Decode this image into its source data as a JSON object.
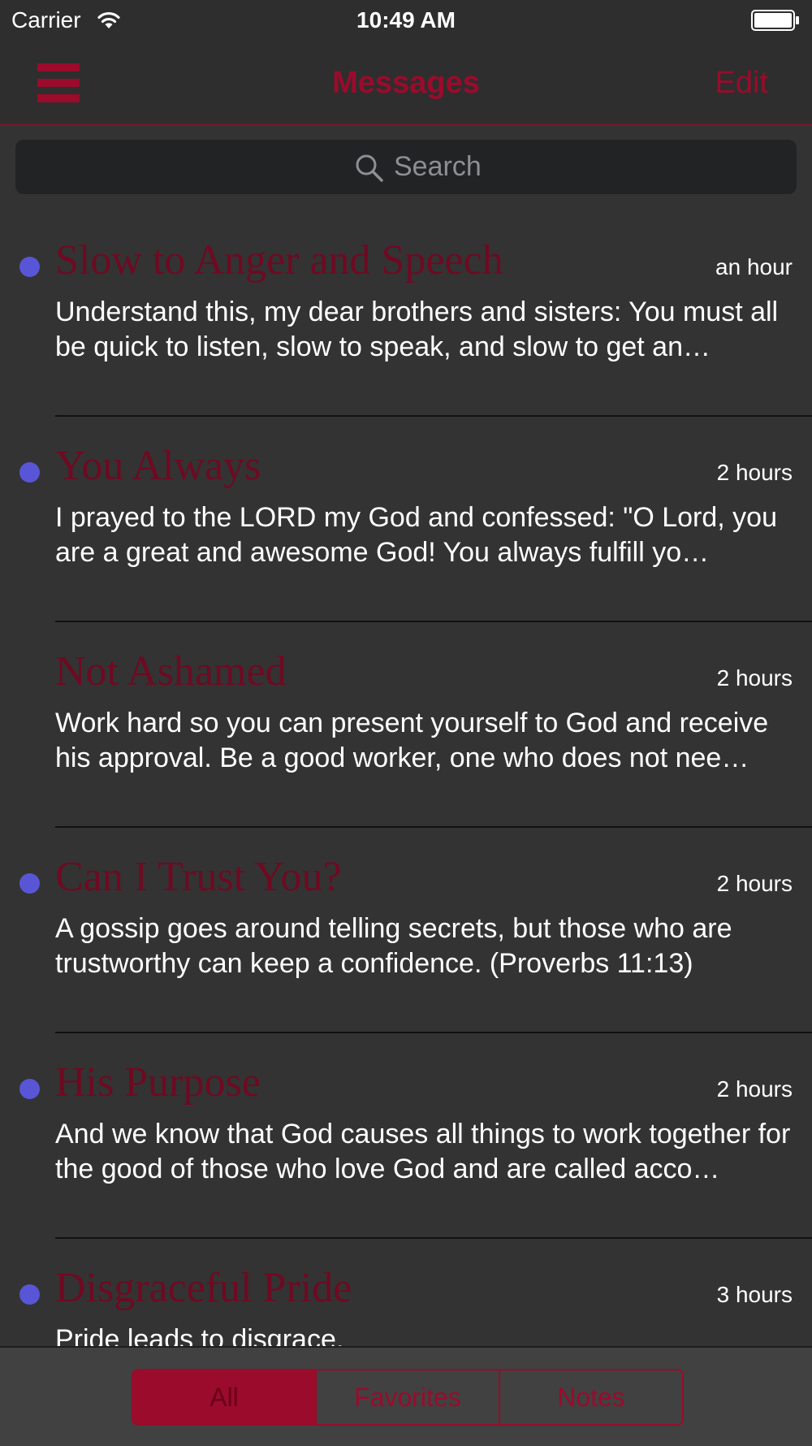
{
  "status_bar": {
    "carrier": "Carrier",
    "time": "10:49 AM"
  },
  "nav": {
    "title": "Messages",
    "edit_label": "Edit"
  },
  "search": {
    "placeholder": "Search"
  },
  "messages": [
    {
      "title": "Slow to Anger and Speech",
      "time": "an hour",
      "body": "Understand this, my dear brothers and sisters: You must all be quick to listen, slow to speak, and slow to get an…",
      "unread": true
    },
    {
      "title": "You Always",
      "time": "2 hours",
      "body": "I prayed to the LORD my God and confessed:  \"O Lord, you are a great and awesome God! You always fulfill yo…",
      "unread": true
    },
    {
      "title": "Not Ashamed",
      "time": "2 hours",
      "body": "Work hard so you can present yourself to God and receive his approval. Be a good worker, one who does not nee…",
      "unread": false
    },
    {
      "title": "Can I Trust You?",
      "time": "2 hours",
      "body": "A gossip goes around telling secrets, but those who are trustworthy can keep a confidence. (Proverbs 11:13)",
      "unread": true
    },
    {
      "title": "His Purpose",
      "time": "2 hours",
      "body": "And we know that God causes all things to work together for the good of those who love God and are called acco…",
      "unread": true
    },
    {
      "title": "Disgraceful Pride",
      "time": "3 hours",
      "body": " Pride leads to disgrace,",
      "unread": true
    }
  ],
  "tabs": {
    "items": [
      "All",
      "Favorites",
      "Notes"
    ],
    "selected": "All"
  },
  "colors": {
    "accent": "#9a0b2c",
    "title_text": "#6e0a22",
    "unread_dot": "#5856d6",
    "background": "#333333",
    "bar_background": "#2e2e2e"
  },
  "icons": [
    "wifi-icon",
    "battery-icon",
    "menu-icon",
    "search-icon"
  ]
}
